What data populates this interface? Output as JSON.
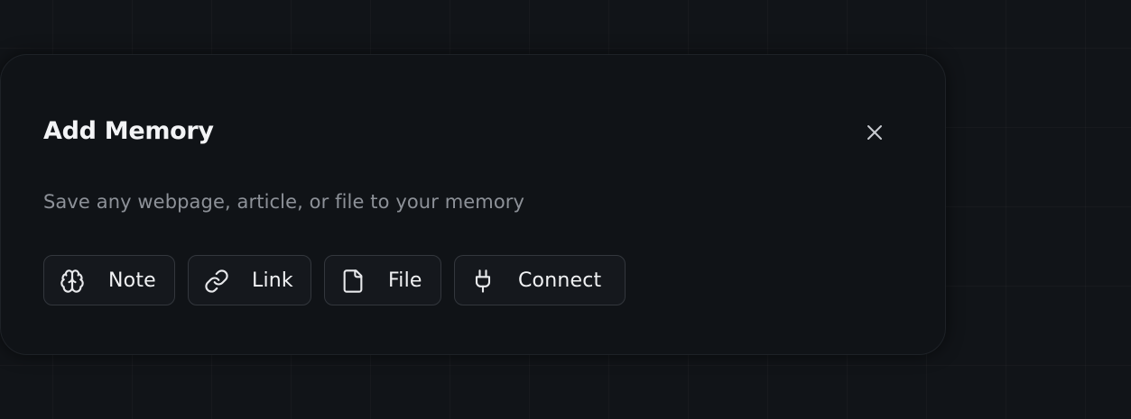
{
  "dialog": {
    "title": "Add Memory",
    "description": "Save any webpage, article, or file to your memory",
    "close_icon": "close-icon"
  },
  "options": [
    {
      "label": "Note",
      "icon": "brain-icon"
    },
    {
      "label": "Link",
      "icon": "link-icon"
    },
    {
      "label": "File",
      "icon": "file-icon"
    },
    {
      "label": "Connect",
      "icon": "plug-icon"
    }
  ],
  "colors": {
    "background": "#111418",
    "modal": "#101317",
    "title": "#f3f4f6",
    "description": "#8d9198",
    "button_border": "#33373d"
  }
}
